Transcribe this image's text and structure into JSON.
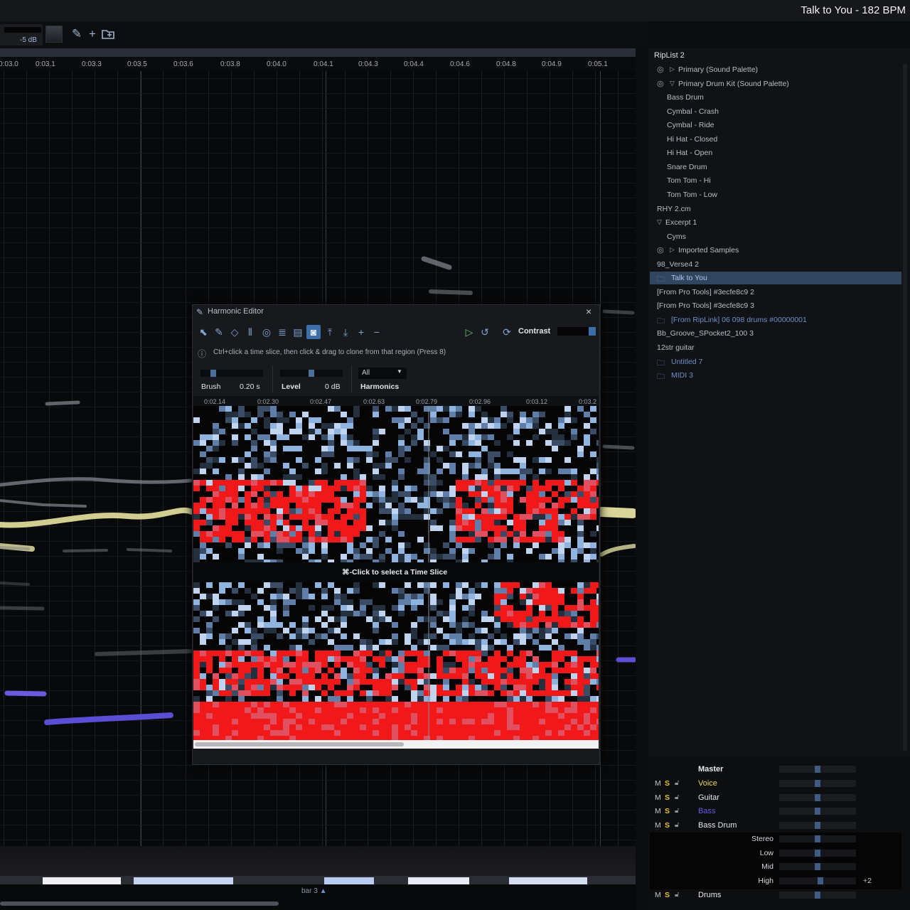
{
  "app": {
    "song_title": "Talk to You - 182 BPM"
  },
  "toolbar": {
    "volume_label": "-5 dB",
    "icons": [
      "pencil-icon",
      "plus-icon",
      "open-folder-icon"
    ]
  },
  "ruler": {
    "ticks": [
      "0:03.0",
      "0:03.1",
      "0:03.3",
      "0:03.5",
      "0:03.6",
      "0:03.8",
      "0:04.0",
      "0:04.1",
      "0:04.3",
      "0:04.4",
      "0:04.6",
      "0:04.8",
      "0:04.9",
      "0:05.1"
    ]
  },
  "overview": {
    "bar_label": "bar 3"
  },
  "harmonic_editor": {
    "title": "Harmonic Editor",
    "close": "×",
    "tools": [
      "select-arrow-icon",
      "brush-icon",
      "eraser-icon",
      "mixer-sliders-icon",
      "lasso-icon",
      "list-icon",
      "film-icon",
      "camera-icon",
      "lift-up-icon",
      "push-down-icon",
      "zoom-in-icon",
      "zoom-out-icon"
    ],
    "contrast_label": "Contrast",
    "hint": "Ctrl+click a time slice, then click & drag to clone from that region  (Press 8)",
    "brush_label": "Brush",
    "brush_value": "0.20 s",
    "level_label": "Level",
    "level_value": "0 dB",
    "harmonics_select": "All",
    "harmonics_label": "Harmonics",
    "times": [
      "0:02.14",
      "0:02.30",
      "0:02.47",
      "0:02.63",
      "0:02.79",
      "0:02.96",
      "0:03.12",
      "0:03.2"
    ],
    "slice_hint": "⌘-Click to select a Time Slice"
  },
  "riplist": {
    "title": "RipList 2",
    "items": [
      {
        "label": "Primary (Sound Palette)"
      },
      {
        "label": "Primary Drum Kit (Sound Palette)"
      },
      {
        "label": "Bass Drum"
      },
      {
        "label": "Cymbal - Crash"
      },
      {
        "label": "Cymbal - Ride"
      },
      {
        "label": "Hi Hat - Closed"
      },
      {
        "label": "Hi Hat - Open"
      },
      {
        "label": "Snare Drum"
      },
      {
        "label": "Tom Tom - Hi"
      },
      {
        "label": "Tom Tom - Low"
      },
      {
        "label": "RHY 2.cm"
      },
      {
        "label": "Excerpt 1"
      },
      {
        "label": "Cyms"
      },
      {
        "label": "Imported Samples"
      },
      {
        "label": "98_Verse4 2"
      },
      {
        "label": "Talk to You"
      },
      {
        "label": "[From Pro Tools] #3ecfe8c9 2"
      },
      {
        "label": "[From Pro Tools] #3ecfe8c9 3"
      },
      {
        "label": "[From RipLink] 06 098 drums #00000001"
      },
      {
        "label": "Bb_Groove_SPocket2_100 3"
      },
      {
        "label": "12str guitar"
      },
      {
        "label": "Untitled 7"
      },
      {
        "label": "MIDI 3"
      }
    ]
  },
  "mixer": {
    "master": "Master",
    "m": "M",
    "s": "S",
    "tracks": [
      {
        "name": "Voice",
        "color": "#e8d85a"
      },
      {
        "name": "Guitar",
        "color": "#e8eaee"
      },
      {
        "name": "Bass",
        "color": "#6a5ae0"
      },
      {
        "name": "Bass Drum",
        "color": "#e8eaee"
      }
    ],
    "sub": [
      "Stereo",
      "Low",
      "Mid",
      "High"
    ],
    "high_value": "+2",
    "drums": "Drums"
  }
}
